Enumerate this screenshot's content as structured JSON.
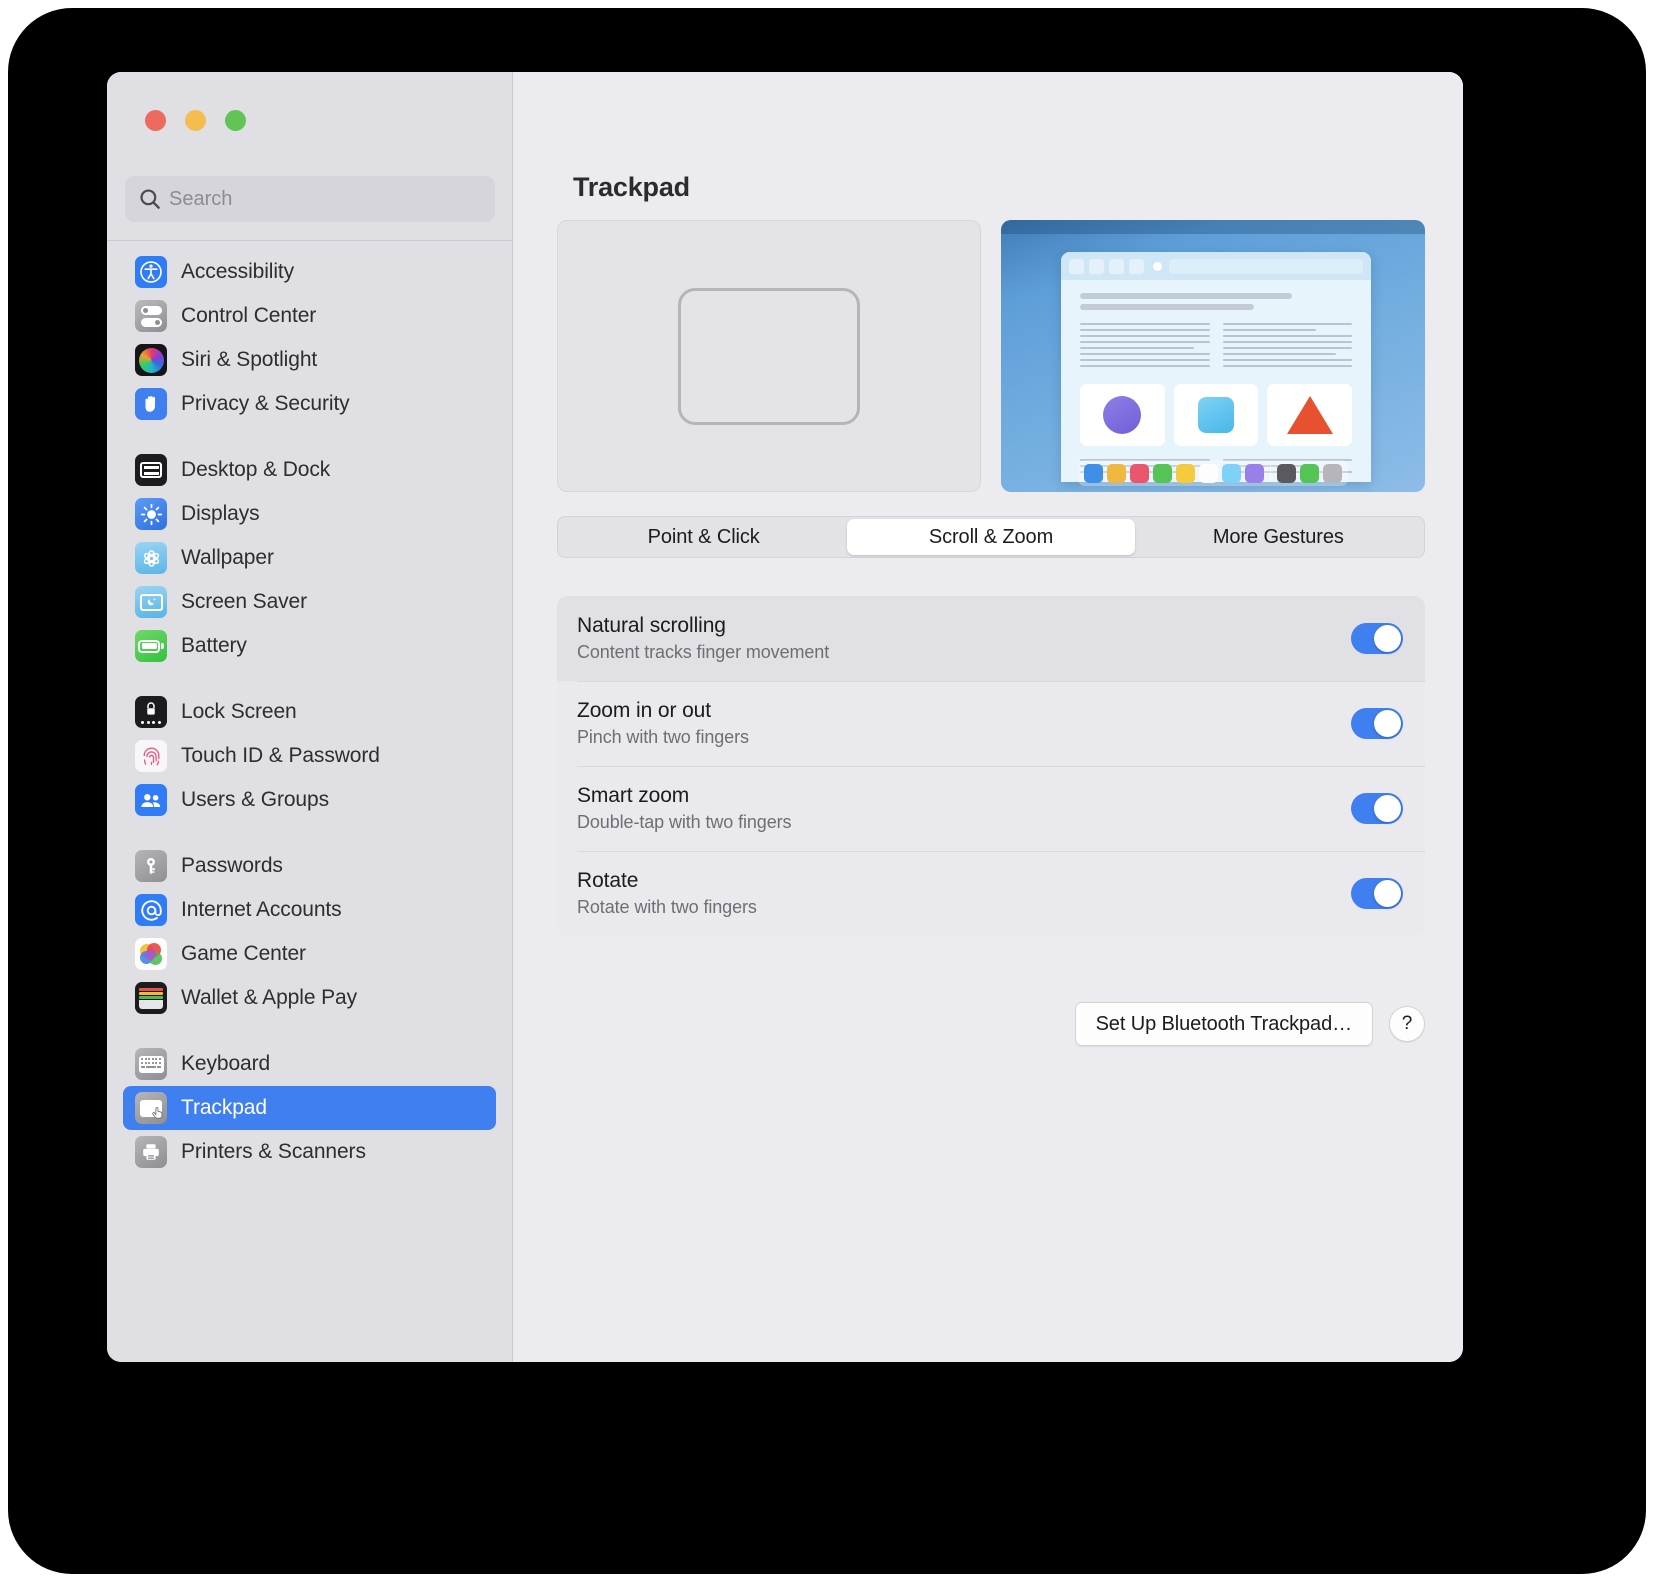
{
  "window": {
    "traffic_lights": [
      "close",
      "minimize",
      "zoom"
    ],
    "colors": {
      "accent": "#3f7ff0",
      "close": "#ec6a5e",
      "minimize": "#f4bd50",
      "zoom": "#61c454",
      "sidebar_bg": "#dfdfe4",
      "content_bg": "#ececf0",
      "selected_row": "#3f7ff0"
    }
  },
  "search": {
    "placeholder": "Search",
    "value": "",
    "icon": "search-icon"
  },
  "sidebar": {
    "groups": [
      {
        "items": [
          {
            "label": "Accessibility",
            "icon": "accessibility-icon",
            "selected": false
          },
          {
            "label": "Control Center",
            "icon": "control-center-icon",
            "selected": false
          },
          {
            "label": "Siri & Spotlight",
            "icon": "siri-icon",
            "selected": false
          },
          {
            "label": "Privacy & Security",
            "icon": "privacy-hand-icon",
            "selected": false
          }
        ]
      },
      {
        "items": [
          {
            "label": "Desktop & Dock",
            "icon": "desktop-dock-icon",
            "selected": false
          },
          {
            "label": "Displays",
            "icon": "displays-sun-icon",
            "selected": false
          },
          {
            "label": "Wallpaper",
            "icon": "wallpaper-icon",
            "selected": false
          },
          {
            "label": "Screen Saver",
            "icon": "screensaver-icon",
            "selected": false
          },
          {
            "label": "Battery",
            "icon": "battery-icon",
            "selected": false
          }
        ]
      },
      {
        "items": [
          {
            "label": "Lock Screen",
            "icon": "lock-screen-icon",
            "selected": false
          },
          {
            "label": "Touch ID & Password",
            "icon": "touch-id-icon",
            "selected": false
          },
          {
            "label": "Users & Groups",
            "icon": "users-groups-icon",
            "selected": false
          }
        ]
      },
      {
        "items": [
          {
            "label": "Passwords",
            "icon": "key-icon",
            "selected": false
          },
          {
            "label": "Internet Accounts",
            "icon": "at-sign-icon",
            "selected": false
          },
          {
            "label": "Game Center",
            "icon": "game-center-icon",
            "selected": false
          },
          {
            "label": "Wallet & Apple Pay",
            "icon": "wallet-icon",
            "selected": false
          }
        ]
      },
      {
        "items": [
          {
            "label": "Keyboard",
            "icon": "keyboard-icon",
            "selected": false
          },
          {
            "label": "Trackpad",
            "icon": "trackpad-icon",
            "selected": true
          },
          {
            "label": "Printers & Scanners",
            "icon": "printer-icon",
            "selected": false
          }
        ]
      }
    ]
  },
  "main": {
    "title": "Trackpad",
    "tabs": [
      {
        "label": "Point & Click",
        "active": false
      },
      {
        "label": "Scroll & Zoom",
        "active": true
      },
      {
        "label": "More Gestures",
        "active": false
      }
    ],
    "settings": [
      {
        "title": "Natural scrolling",
        "subtitle": "Content tracks finger movement",
        "enabled": true,
        "highlighted": true
      },
      {
        "title": "Zoom in or out",
        "subtitle": "Pinch with two fingers",
        "enabled": true,
        "highlighted": false
      },
      {
        "title": "Smart zoom",
        "subtitle": "Double-tap with two fingers",
        "enabled": true,
        "highlighted": false
      },
      {
        "title": "Rotate",
        "subtitle": "Rotate with two fingers",
        "enabled": true,
        "highlighted": false
      }
    ],
    "footer": {
      "bluetooth_button": "Set Up Bluetooth Trackpad…",
      "help_button": "?"
    },
    "preview": {
      "dock_colors": [
        "#3f8fe8",
        "#f0b83e",
        "#e9566e",
        "#55c457",
        "#f3cb3c",
        "#fdfdfd",
        "#7fd2f5",
        "#9a7fe8",
        "#5a5a5e",
        "#55c457",
        "#b5b5ba"
      ]
    }
  }
}
